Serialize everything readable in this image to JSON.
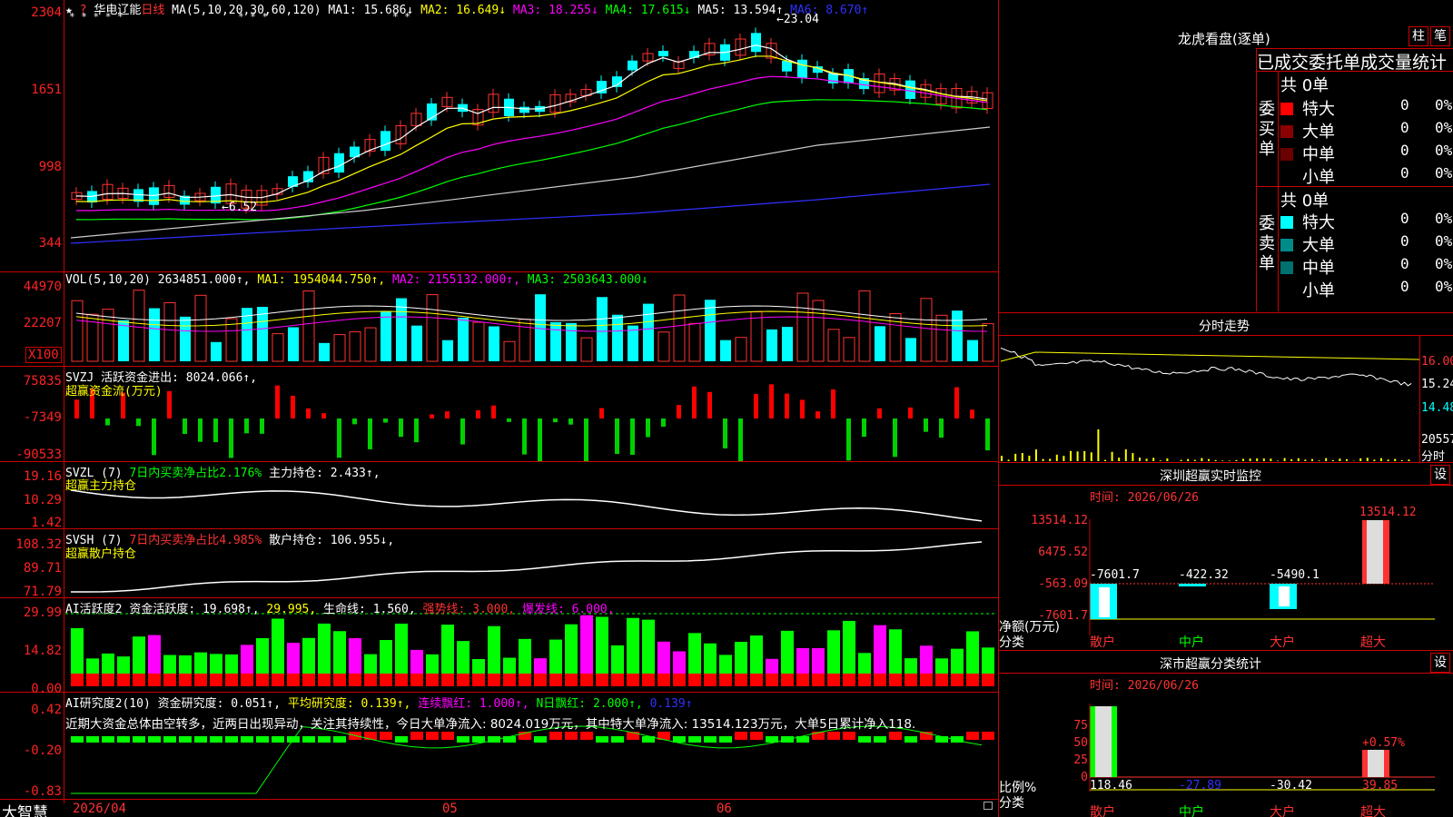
{
  "stock": {
    "icon_text": "★",
    "name": "华电辽能",
    "period": "日线",
    "ma_label": "MA(5,10,20,30,60,120)",
    "ma1": "MA1: 15.686↓",
    "ma2": "MA2: 16.649↓",
    "ma3": "MA3: 18.255↓",
    "ma4": "MA4: 17.615↓",
    "ma5": "MA5: 13.594↑",
    "ma6": "MA6: 8.670↑",
    "question": "?",
    "high_mark": "23.04",
    "low_mark": "6.52",
    "star_row_left": "* * * * *",
    "star_row_mid": "* * *",
    "star_row_mid2": "* *"
  },
  "price_axis": [
    "2304",
    "1651",
    "998",
    "344"
  ],
  "vol": {
    "label": "VOL(5,10,20)",
    "value": "2634851.000↑,",
    "ma1": "MA1: 1954044.750↑,",
    "ma2": "MA2: 2155132.000↑,",
    "ma3": "MA3: 2503643.000↓",
    "axis": [
      "44970",
      "22207"
    ],
    "unit": "X100"
  },
  "svzj": {
    "label": "SVZJ  活跃资金进出: 8024.066↑,",
    "sub": "超赢资金流(万元)",
    "axis": [
      "75835",
      "-7349",
      "-90533"
    ]
  },
  "svzl": {
    "label": "SVZL (7)",
    "net": "7日内买卖净占比2.176%",
    "main": "主力持仓: 2.433↑,",
    "sub": "超赢主力持仓",
    "axis": [
      "19.16",
      "10.29",
      "1.42"
    ]
  },
  "svsh": {
    "label": "SVSH (7)",
    "net": "7日内买卖净占比4.985%",
    "retail": "散户持仓: 106.955↓,",
    "sub": "超赢散户持仓",
    "axis": [
      "108.32",
      "89.71",
      "71.79"
    ]
  },
  "ai1": {
    "label": "AI活跃度2",
    "act": "资金活跃度: 19.698↑,",
    "v2": "29.995,",
    "life": "生命线: 1.560,",
    "strong": "强势线: 3.000,",
    "burst": "爆发线: 6.000,",
    "axis": [
      "29.99",
      "14.82",
      "0.00"
    ]
  },
  "ai2": {
    "label": "AI研究度2(10)",
    "res": "资金研究度: 0.051↑,",
    "avg": "平均研究度: 0.139↑,",
    "cont": "连续飘红: 1.000↑,",
    "nday": "N日飘红: 2.000↑,",
    "last": "0.139↑",
    "axis": [
      "0.42",
      "-0.20",
      "-0.83"
    ],
    "text": "近期大资金总体由空转多，近两日出现异动，关注其持续性，今日大单净流入: 8024.019万元，其中特大单净流入: 13514.123万元，大单5日累计净入118."
  },
  "date_axis": {
    "brand": "大智慧",
    "d1": "2026/04",
    "d2": "05",
    "d3": "06"
  },
  "dragon": {
    "title": "龙虎看盘(逐单)",
    "btn1": "柱",
    "btn2": "笔",
    "header": "已成交委托单成交量统计",
    "buy_label": "委买单",
    "sell_label": "委卖单",
    "buy_total": "共 0单",
    "sell_total": "共 0单",
    "buy_rows": [
      {
        "name": "特大",
        "v": "0",
        "p": "0%",
        "color": "#ff0000"
      },
      {
        "name": "大单",
        "v": "0",
        "p": "0%",
        "color": "#8b0000"
      },
      {
        "name": "中单",
        "v": "0",
        "p": "0%",
        "color": "#6b0000"
      },
      {
        "name": "小单",
        "v": "0",
        "p": "0%",
        "color": "#000000"
      }
    ],
    "sell_rows": [
      {
        "name": "特大",
        "v": "0",
        "p": "0%",
        "color": "#00ffff"
      },
      {
        "name": "大单",
        "v": "0",
        "p": "0%",
        "color": "#008b8b"
      },
      {
        "name": "中单",
        "v": "0",
        "p": "0%",
        "color": "#007070"
      },
      {
        "name": "小单",
        "v": "0",
        "p": "0%",
        "color": "#000000"
      }
    ]
  },
  "fenshi": {
    "title": "分时走势",
    "axis": [
      "16.00",
      "15.24",
      "14.48"
    ],
    "vol_axis": "20557",
    "vol_unit": "分时"
  },
  "sz_monitor": {
    "title": "深圳超赢实时监控",
    "btn": "设",
    "time": "时间: 2026/06/26",
    "axis": [
      "13514.12",
      "6475.52",
      "-563.09",
      "-7601.7"
    ],
    "ylabel": "净额(万元)",
    "xlabel": "分类",
    "cats": [
      "散户",
      "中户",
      "大户",
      "超大"
    ],
    "values": [
      "-7601.7",
      "-422.32",
      "-5490.1",
      "13514.12"
    ]
  },
  "sz_class": {
    "title": "深市超赢分类统计",
    "btn": "设",
    "time": "时间: 2026/06/26",
    "axis": [
      "75",
      "50",
      "25",
      "0"
    ],
    "ylabel": "比例%",
    "xlabel": "分类",
    "cats": [
      "散户",
      "中户",
      "大户",
      "超大"
    ],
    "values": [
      "118.46",
      "-27.89",
      "-30.42",
      "39.85"
    ],
    "pct": "+0.57%"
  }
}
